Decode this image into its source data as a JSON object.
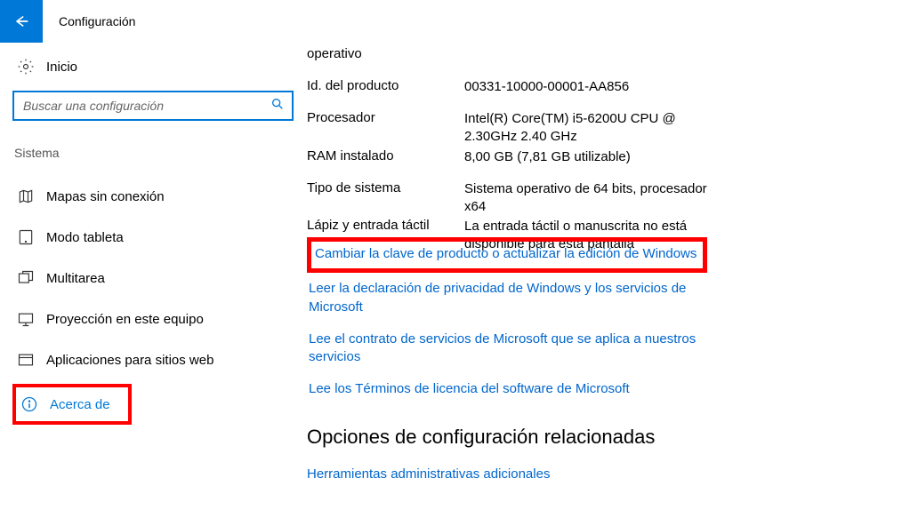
{
  "app": {
    "title": "Configuración"
  },
  "sidebar": {
    "home_label": "Inicio",
    "search_placeholder": "Buscar una configuración",
    "section_title": "Sistema",
    "items": [
      {
        "label": "Mapas sin conexión"
      },
      {
        "label": "Modo tableta"
      },
      {
        "label": "Multitarea"
      },
      {
        "label": "Proyección en este equipo"
      },
      {
        "label": "Aplicaciones para sitios web"
      },
      {
        "label": "Acerca de"
      }
    ]
  },
  "main": {
    "spec_rows": [
      {
        "key": "operativo",
        "value": ""
      },
      {
        "key": "Id. del producto",
        "value": "00331-10000-00001-AA856"
      },
      {
        "key": "Procesador",
        "value": "Intel(R) Core(TM) i5-6200U CPU @ 2.30GHz   2.40 GHz"
      },
      {
        "key": "RAM instalado",
        "value": "8,00 GB (7,81 GB utilizable)"
      },
      {
        "key": "Tipo de sistema",
        "value": "Sistema operativo de 64 bits, procesador x64"
      },
      {
        "key": "Lápiz y entrada táctil",
        "value": "La entrada táctil o manuscrita no está disponible para esta pantalla"
      }
    ],
    "links": [
      {
        "text": "Cambiar la clave de producto o actualizar la edición de Windows",
        "highlighted": true
      },
      {
        "text": "Leer la declaración de privacidad de Windows y los servicios de Microsoft"
      },
      {
        "text": "Lee el contrato de servicios de Microsoft que se aplica a nuestros servicios"
      },
      {
        "text": "Lee los Términos de licencia del software de Microsoft"
      }
    ],
    "related": {
      "header": "Opciones de configuración relacionadas",
      "link": "Herramientas administrativas adicionales"
    }
  }
}
